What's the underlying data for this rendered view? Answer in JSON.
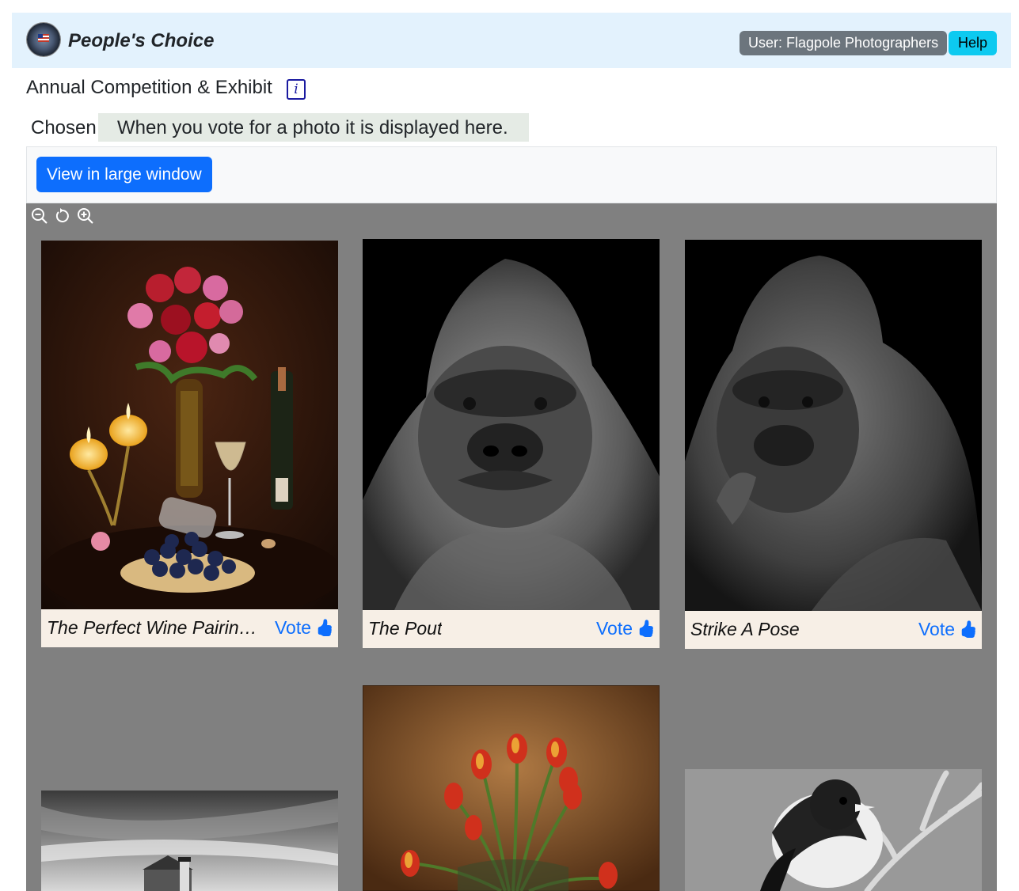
{
  "navbar": {
    "brand": "People's Choice",
    "user_badge": "User: Flagpole Photographers",
    "help": "Help"
  },
  "subtitle": "Annual Competition & Exhibit",
  "info_icon_glyph": "i",
  "chosen": {
    "label": "Chosen",
    "placeholder": "When you vote for a photo it is displayed here."
  },
  "view_button": "View in large window",
  "zoom": {
    "icons": [
      "zoom-out-icon",
      "reset-icon",
      "zoom-in-icon"
    ]
  },
  "photos": [
    {
      "title": "The Perfect Wine Pairing: Romance",
      "title_display": "The Perfect Wine Pairing: ...",
      "vote_label": "Vote",
      "icon": "thumbs-up-icon"
    },
    {
      "title": "The Pout",
      "vote_label": "Vote",
      "icon": "thumbs-up-icon"
    },
    {
      "title": "Strike A Pose",
      "vote_label": "Vote",
      "icon": "thumbs-up-icon"
    }
  ],
  "colors": {
    "navbar_bg": "#e3f2fd",
    "primary": "#0d6efd",
    "secondary": "#6c757d",
    "info": "#0dcaf0",
    "gallery_bg": "#808080",
    "caption_bg": "#f7efe6"
  }
}
